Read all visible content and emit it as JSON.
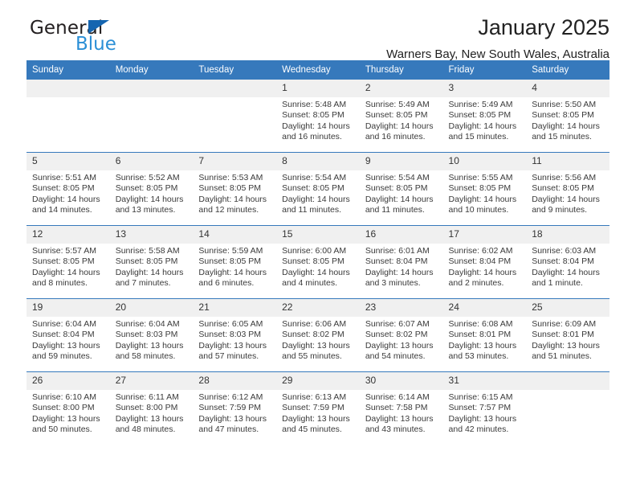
{
  "brand": {
    "word_one": "General",
    "word_two": "Blue",
    "accent_color": "#1565b0",
    "secondary_color": "#2b8fd6"
  },
  "header": {
    "title": "January 2025",
    "subtitle": "Warners Bay, New South Wales, Australia"
  },
  "theme": {
    "header_blue": "#3679bc",
    "daynum_band": "#f0f0f0"
  },
  "weekday_headers": [
    "Sunday",
    "Monday",
    "Tuesday",
    "Wednesday",
    "Thursday",
    "Friday",
    "Saturday"
  ],
  "labels": {
    "sunrise_prefix": "Sunrise:",
    "sunset_prefix": "Sunset:",
    "daylight_prefix": "Daylight:"
  },
  "weeks": [
    [
      {
        "day": "",
        "empty": true
      },
      {
        "day": "",
        "empty": true
      },
      {
        "day": "",
        "empty": true
      },
      {
        "day": "1",
        "sunrise": "Sunrise: 5:48 AM",
        "sunset": "Sunset: 8:05 PM",
        "daylight": "Daylight: 14 hours and 16 minutes."
      },
      {
        "day": "2",
        "sunrise": "Sunrise: 5:49 AM",
        "sunset": "Sunset: 8:05 PM",
        "daylight": "Daylight: 14 hours and 16 minutes."
      },
      {
        "day": "3",
        "sunrise": "Sunrise: 5:49 AM",
        "sunset": "Sunset: 8:05 PM",
        "daylight": "Daylight: 14 hours and 15 minutes."
      },
      {
        "day": "4",
        "sunrise": "Sunrise: 5:50 AM",
        "sunset": "Sunset: 8:05 PM",
        "daylight": "Daylight: 14 hours and 15 minutes."
      }
    ],
    [
      {
        "day": "5",
        "sunrise": "Sunrise: 5:51 AM",
        "sunset": "Sunset: 8:05 PM",
        "daylight": "Daylight: 14 hours and 14 minutes."
      },
      {
        "day": "6",
        "sunrise": "Sunrise: 5:52 AM",
        "sunset": "Sunset: 8:05 PM",
        "daylight": "Daylight: 14 hours and 13 minutes."
      },
      {
        "day": "7",
        "sunrise": "Sunrise: 5:53 AM",
        "sunset": "Sunset: 8:05 PM",
        "daylight": "Daylight: 14 hours and 12 minutes."
      },
      {
        "day": "8",
        "sunrise": "Sunrise: 5:54 AM",
        "sunset": "Sunset: 8:05 PM",
        "daylight": "Daylight: 14 hours and 11 minutes."
      },
      {
        "day": "9",
        "sunrise": "Sunrise: 5:54 AM",
        "sunset": "Sunset: 8:05 PM",
        "daylight": "Daylight: 14 hours and 11 minutes."
      },
      {
        "day": "10",
        "sunrise": "Sunrise: 5:55 AM",
        "sunset": "Sunset: 8:05 PM",
        "daylight": "Daylight: 14 hours and 10 minutes."
      },
      {
        "day": "11",
        "sunrise": "Sunrise: 5:56 AM",
        "sunset": "Sunset: 8:05 PM",
        "daylight": "Daylight: 14 hours and 9 minutes."
      }
    ],
    [
      {
        "day": "12",
        "sunrise": "Sunrise: 5:57 AM",
        "sunset": "Sunset: 8:05 PM",
        "daylight": "Daylight: 14 hours and 8 minutes."
      },
      {
        "day": "13",
        "sunrise": "Sunrise: 5:58 AM",
        "sunset": "Sunset: 8:05 PM",
        "daylight": "Daylight: 14 hours and 7 minutes."
      },
      {
        "day": "14",
        "sunrise": "Sunrise: 5:59 AM",
        "sunset": "Sunset: 8:05 PM",
        "daylight": "Daylight: 14 hours and 6 minutes."
      },
      {
        "day": "15",
        "sunrise": "Sunrise: 6:00 AM",
        "sunset": "Sunset: 8:05 PM",
        "daylight": "Daylight: 14 hours and 4 minutes."
      },
      {
        "day": "16",
        "sunrise": "Sunrise: 6:01 AM",
        "sunset": "Sunset: 8:04 PM",
        "daylight": "Daylight: 14 hours and 3 minutes."
      },
      {
        "day": "17",
        "sunrise": "Sunrise: 6:02 AM",
        "sunset": "Sunset: 8:04 PM",
        "daylight": "Daylight: 14 hours and 2 minutes."
      },
      {
        "day": "18",
        "sunrise": "Sunrise: 6:03 AM",
        "sunset": "Sunset: 8:04 PM",
        "daylight": "Daylight: 14 hours and 1 minute."
      }
    ],
    [
      {
        "day": "19",
        "sunrise": "Sunrise: 6:04 AM",
        "sunset": "Sunset: 8:04 PM",
        "daylight": "Daylight: 13 hours and 59 minutes."
      },
      {
        "day": "20",
        "sunrise": "Sunrise: 6:04 AM",
        "sunset": "Sunset: 8:03 PM",
        "daylight": "Daylight: 13 hours and 58 minutes."
      },
      {
        "day": "21",
        "sunrise": "Sunrise: 6:05 AM",
        "sunset": "Sunset: 8:03 PM",
        "daylight": "Daylight: 13 hours and 57 minutes."
      },
      {
        "day": "22",
        "sunrise": "Sunrise: 6:06 AM",
        "sunset": "Sunset: 8:02 PM",
        "daylight": "Daylight: 13 hours and 55 minutes."
      },
      {
        "day": "23",
        "sunrise": "Sunrise: 6:07 AM",
        "sunset": "Sunset: 8:02 PM",
        "daylight": "Daylight: 13 hours and 54 minutes."
      },
      {
        "day": "24",
        "sunrise": "Sunrise: 6:08 AM",
        "sunset": "Sunset: 8:01 PM",
        "daylight": "Daylight: 13 hours and 53 minutes."
      },
      {
        "day": "25",
        "sunrise": "Sunrise: 6:09 AM",
        "sunset": "Sunset: 8:01 PM",
        "daylight": "Daylight: 13 hours and 51 minutes."
      }
    ],
    [
      {
        "day": "26",
        "sunrise": "Sunrise: 6:10 AM",
        "sunset": "Sunset: 8:00 PM",
        "daylight": "Daylight: 13 hours and 50 minutes."
      },
      {
        "day": "27",
        "sunrise": "Sunrise: 6:11 AM",
        "sunset": "Sunset: 8:00 PM",
        "daylight": "Daylight: 13 hours and 48 minutes."
      },
      {
        "day": "28",
        "sunrise": "Sunrise: 6:12 AM",
        "sunset": "Sunset: 7:59 PM",
        "daylight": "Daylight: 13 hours and 47 minutes."
      },
      {
        "day": "29",
        "sunrise": "Sunrise: 6:13 AM",
        "sunset": "Sunset: 7:59 PM",
        "daylight": "Daylight: 13 hours and 45 minutes."
      },
      {
        "day": "30",
        "sunrise": "Sunrise: 6:14 AM",
        "sunset": "Sunset: 7:58 PM",
        "daylight": "Daylight: 13 hours and 43 minutes."
      },
      {
        "day": "31",
        "sunrise": "Sunrise: 6:15 AM",
        "sunset": "Sunset: 7:57 PM",
        "daylight": "Daylight: 13 hours and 42 minutes."
      },
      {
        "day": "",
        "empty": true
      }
    ]
  ]
}
